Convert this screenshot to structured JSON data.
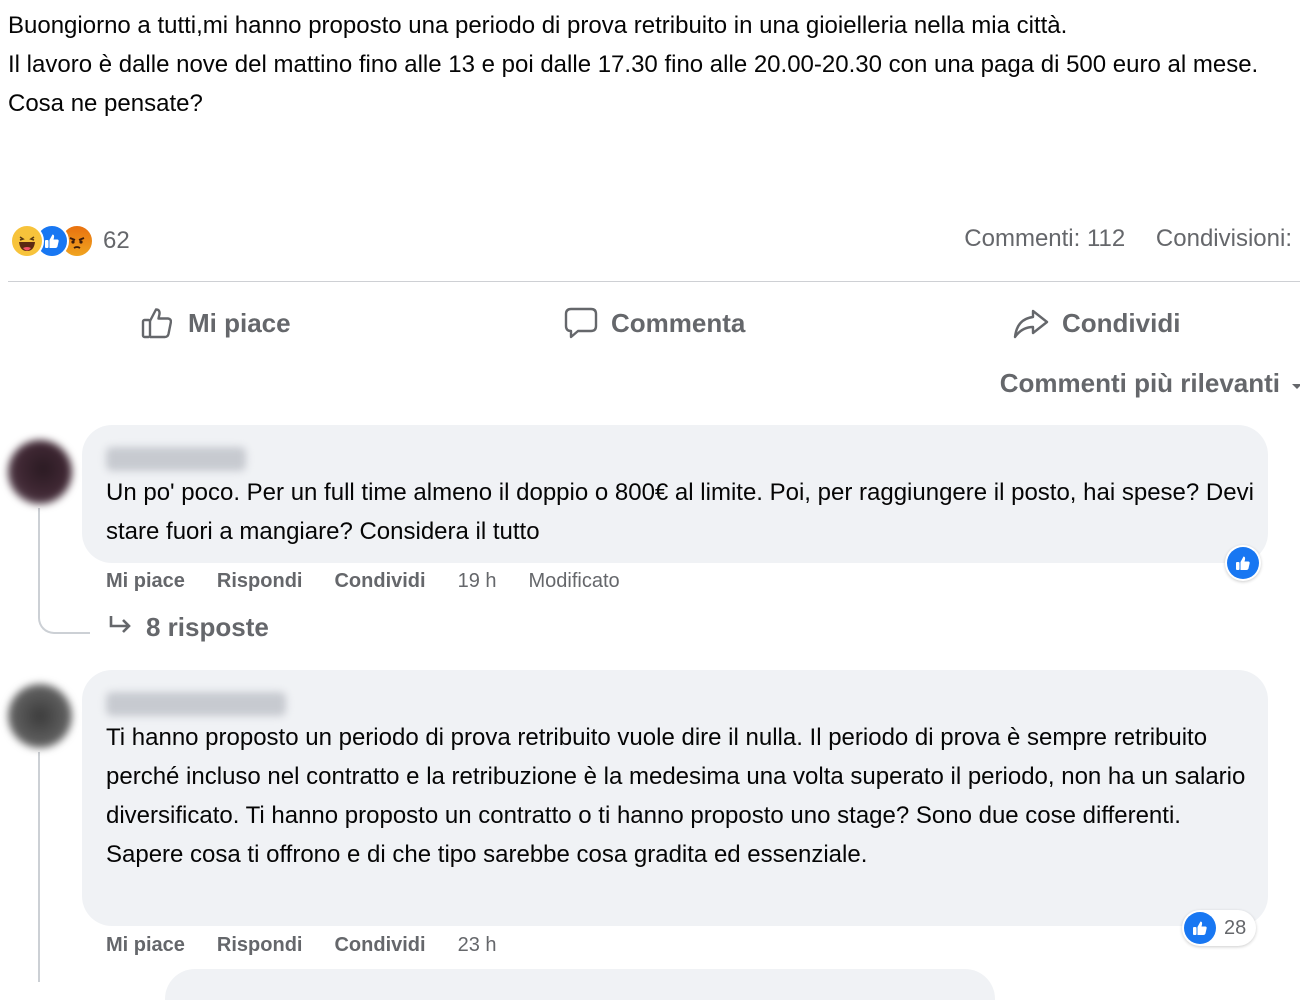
{
  "post": {
    "paragraphs": [
      "Buongiorno a tutti,mi hanno proposto una periodo di prova retribuito in una gioielleria nella mia città.",
      "Il lavoro è dalle nove del mattino fino alle 13 e poi dalle 17.30 fino alle 20.00-20.30 con una paga di 500 euro al mese.",
      "Cosa ne pensate?"
    ],
    "reactions": {
      "icons": [
        "haha-reaction-icon",
        "like-reaction-icon",
        "angry-reaction-icon"
      ],
      "count": "62"
    },
    "comments_count": "Commenti: 112",
    "shares_count": "Condivisioni:"
  },
  "actions": {
    "like": "Mi piace",
    "comment": "Commenta",
    "share": "Condividi"
  },
  "sort": {
    "label": "Commenti più rilevanti"
  },
  "comments": [
    {
      "text": "Un po' poco. Per un full time almeno il doppio o 800€ al limite. Poi, per raggiungere il posto, hai spese? Devi stare fuori a mangiare? Considera il tutto",
      "like_label": "Mi piace",
      "reply_label": "Rispondi",
      "share_label": "Condividi",
      "time": "19 h",
      "edited": "Modificato",
      "replies": "8 risposte"
    },
    {
      "text": "Ti hanno proposto un periodo di prova retribuito vuole dire il nulla. Il periodo di prova è sempre retribuito perché incluso nel contratto e la retribuzione è la medesima una volta superato il periodo, non ha un salario diversificato. Ti hanno proposto un contratto o ti hanno proposto uno stage? Sono due cose differenti. Sapere cosa ti offrono e di che tipo sarebbe cosa gradita ed essenziale.",
      "like_label": "Mi piace",
      "reply_label": "Rispondi",
      "share_label": "Condividi",
      "time": "23 h",
      "like_count": "28"
    }
  ],
  "colors": {
    "like_blue": "#1877f2",
    "secondary_text": "#65676b",
    "bubble_bg": "#f0f2f5"
  }
}
